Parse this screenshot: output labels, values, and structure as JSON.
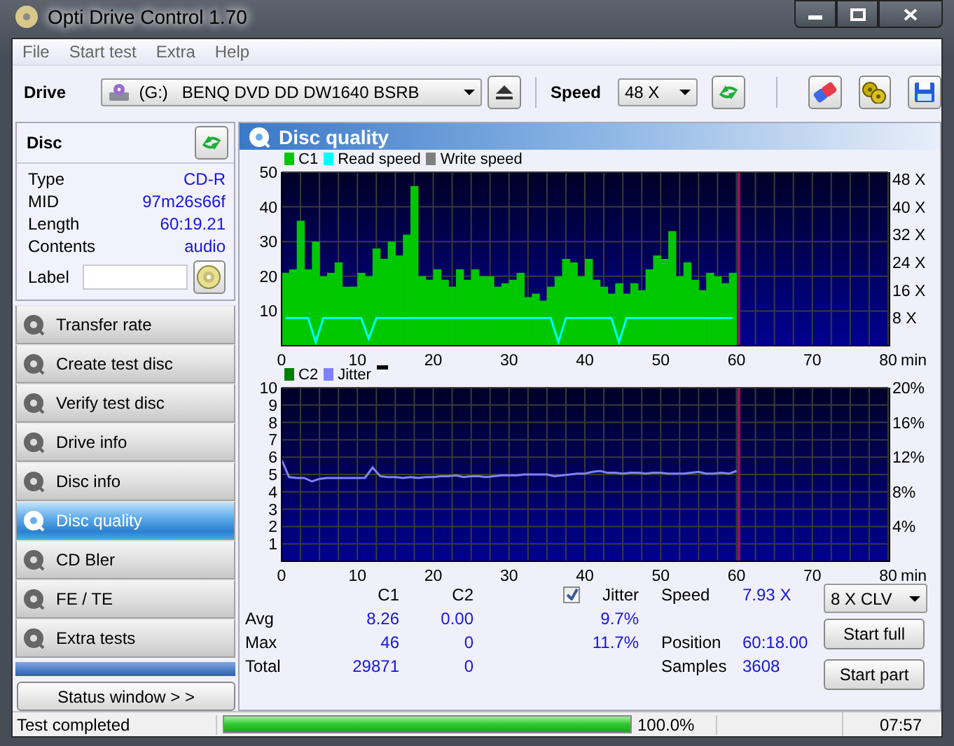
{
  "window": {
    "title": "Opti Drive Control 1.70"
  },
  "menu": [
    "File",
    "Start test",
    "Extra",
    "Help"
  ],
  "toolbar": {
    "drive_label": "Drive",
    "drive": "(G:)   BENQ DVD DD DW1640 BSRB",
    "speed_label": "Speed",
    "speed": "48 X"
  },
  "disc": {
    "title": "Disc",
    "info": [
      {
        "label": "Type",
        "value": "CD-R"
      },
      {
        "label": "MID",
        "value": "97m26s66f"
      },
      {
        "label": "Length",
        "value": "60:19.21"
      },
      {
        "label": "Contents",
        "value": "audio"
      }
    ],
    "label_field": "Label"
  },
  "nav": [
    {
      "label": "Transfer rate",
      "selected": false
    },
    {
      "label": "Create test disc",
      "selected": false
    },
    {
      "label": "Verify test disc",
      "selected": false
    },
    {
      "label": "Drive info",
      "selected": false
    },
    {
      "label": "Disc info",
      "selected": false
    },
    {
      "label": "Disc quality",
      "selected": true
    },
    {
      "label": "CD Bler",
      "selected": false
    },
    {
      "label": "FE / TE",
      "selected": false
    },
    {
      "label": "Extra tests",
      "selected": false
    }
  ],
  "status_window_button": "Status window > >",
  "panel": {
    "title": "Disc quality",
    "charts": [
      {
        "chart_data": {
          "type": "bar",
          "grid": true,
          "xlabel": "min",
          "xlim": [
            0,
            80
          ],
          "ylim": [
            0,
            50
          ],
          "xticks": [
            0,
            10,
            20,
            30,
            40,
            50,
            60,
            70,
            80
          ],
          "yticks": [
            10,
            20,
            30,
            40,
            50
          ],
          "y2lim": [
            0,
            50
          ],
          "y2ticks": [
            {
              "value": 8,
              "label": "8 X"
            },
            {
              "value": 16,
              "label": "16 X"
            },
            {
              "value": 24,
              "label": "24 X"
            },
            {
              "value": 32,
              "label": "32 X"
            },
            {
              "value": 40,
              "label": "40 X"
            },
            {
              "value": 48,
              "label": "48 X"
            }
          ],
          "x": [
            0.5,
            1.5,
            2.5,
            3.5,
            4.5,
            5.5,
            6.5,
            7.5,
            8.5,
            9.5,
            10.5,
            11.5,
            12.5,
            13.5,
            14.5,
            15.5,
            16.5,
            17.5,
            18.5,
            19.5,
            20.5,
            21.5,
            22.5,
            23.5,
            24.5,
            25.5,
            26.5,
            27.5,
            28.5,
            29.5,
            30.5,
            31.5,
            32.5,
            33.5,
            34.5,
            35.5,
            36.5,
            37.5,
            38.5,
            39.5,
            40.5,
            41.5,
            42.5,
            43.5,
            44.5,
            45.5,
            46.5,
            47.5,
            48.5,
            49.5,
            50.5,
            51.5,
            52.5,
            53.5,
            54.5,
            55.5,
            56.5,
            57.5,
            58.5,
            59.5
          ],
          "ref_lines": [
            {
              "axis": "x",
              "value": 60.3,
              "color": "#99106a"
            }
          ],
          "series": [
            {
              "name": "C1",
              "color": "#00c800",
              "values": [
                21,
                22,
                36,
                22,
                30,
                20,
                21,
                24,
                17,
                17,
                21,
                20,
                28,
                25,
                30,
                26,
                32,
                46,
                20,
                19,
                22,
                19,
                17,
                22,
                19,
                22,
                20,
                20,
                17,
                18,
                19,
                21,
                14,
                15,
                13,
                17,
                20,
                25,
                24,
                20,
                25,
                19,
                17,
                15,
                18,
                15,
                18,
                16,
                22,
                26,
                25,
                33,
                20,
                24,
                19,
                16,
                21,
                20,
                18,
                21
              ]
            },
            {
              "name": "Read speed",
              "color": "#00ffff",
              "type": "line",
              "axis": "y2",
              "values": [
                8,
                8,
                8,
                8,
                1,
                8,
                8,
                8,
                8,
                8,
                8,
                2,
                8,
                8,
                8,
                8,
                8,
                8,
                8,
                8,
                8,
                8,
                8,
                8,
                8,
                8,
                8,
                8,
                8,
                8,
                8,
                8,
                8,
                8,
                8,
                8,
                1,
                8,
                8,
                8,
                8,
                8,
                8,
                8,
                1,
                8,
                8,
                8,
                8,
                8,
                8,
                8,
                8,
                8,
                8,
                8,
                8,
                8,
                8,
                8
              ]
            },
            {
              "name": "Write speed",
              "color": "#808080",
              "type": "line",
              "axis": "y2",
              "values": [
                null,
                null,
                null,
                null,
                null,
                null,
                null,
                null,
                null,
                null,
                null,
                null,
                null,
                null,
                null,
                null,
                null,
                null,
                null,
                null,
                null,
                null,
                null,
                null,
                null,
                null,
                null,
                null,
                null,
                null,
                null,
                null,
                null,
                null,
                null,
                null,
                null,
                null,
                null,
                null,
                null,
                null,
                null,
                null,
                null,
                null,
                null,
                null,
                null,
                null,
                null,
                null,
                null,
                null,
                null,
                null,
                null,
                null,
                null,
                null
              ]
            }
          ]
        }
      },
      {
        "chart_data": {
          "type": "bar",
          "grid": true,
          "xlabel": "min",
          "xlim": [
            0,
            80
          ],
          "ylim": [
            0,
            10
          ],
          "xticks": [
            0,
            10,
            20,
            30,
            40,
            50,
            60,
            70,
            80
          ],
          "yticks": [
            1,
            2,
            3,
            4,
            5,
            6,
            7,
            8,
            9,
            10
          ],
          "y2lim": [
            0,
            20
          ],
          "y2ticks": [
            {
              "value": 4,
              "label": "4%"
            },
            {
              "value": 8,
              "label": "8%"
            },
            {
              "value": 12,
              "label": "12%"
            },
            {
              "value": 16,
              "label": "16%"
            },
            {
              "value": 20,
              "label": "20%"
            }
          ],
          "x": [
            0,
            1,
            2,
            3,
            4,
            5,
            6,
            7,
            8,
            9,
            10,
            11,
            12,
            13,
            14,
            15,
            16,
            17,
            18,
            19,
            20,
            21,
            22,
            23,
            24,
            25,
            26,
            27,
            28,
            29,
            30,
            31,
            32,
            33,
            34,
            35,
            36,
            37,
            38,
            39,
            40,
            41,
            42,
            43,
            44,
            45,
            46,
            47,
            48,
            49,
            50,
            51,
            52,
            53,
            54,
            55,
            56,
            57,
            58,
            59,
            60
          ],
          "ref_lines": [
            {
              "axis": "x",
              "value": 60.3,
              "color": "#99106a"
            }
          ],
          "series": [
            {
              "name": "C2",
              "color": "#008000",
              "values": [
                0,
                0,
                0,
                0,
                0,
                0,
                0,
                0,
                0,
                0,
                0,
                0,
                0,
                0,
                0,
                0,
                0,
                0,
                0,
                0,
                0,
                0,
                0,
                0,
                0,
                0,
                0,
                0,
                0,
                0,
                0,
                0,
                0,
                0,
                0,
                0,
                0,
                0,
                0,
                0,
                0,
                0,
                0,
                0,
                0,
                0,
                0,
                0,
                0,
                0,
                0,
                0,
                0,
                0,
                0,
                0,
                0,
                0,
                0,
                0,
                0
              ]
            },
            {
              "name": "Jitter",
              "color": "#8080ff",
              "type": "line",
              "axis": "y2",
              "values": [
                11.7,
                9.7,
                9.6,
                9.6,
                9.2,
                9.5,
                9.6,
                9.6,
                9.6,
                9.6,
                9.6,
                9.6,
                10.8,
                9.8,
                9.7,
                9.7,
                9.6,
                9.7,
                9.6,
                9.7,
                9.7,
                9.8,
                9.8,
                9.9,
                9.7,
                9.8,
                9.8,
                9.7,
                9.8,
                9.9,
                9.9,
                9.9,
                10,
                10,
                10,
                10,
                9.8,
                9.9,
                10,
                10.1,
                10.1,
                10.3,
                10.4,
                10.2,
                10.2,
                10.1,
                10.2,
                10.2,
                10.1,
                10.2,
                10.2,
                10.1,
                10.1,
                10.1,
                10.2,
                10.3,
                10.1,
                10.1,
                10.2,
                10.1,
                10.4
              ]
            }
          ]
        }
      }
    ],
    "stats": {
      "columns": [
        "C1",
        "C2"
      ],
      "jitter": {
        "label": "Jitter",
        "checked": true
      },
      "rows": [
        {
          "label": "Avg",
          "c1": "8.26",
          "c2": "0.00",
          "jitter": "9.7%"
        },
        {
          "label": "Max",
          "c1": "46",
          "c2": "0",
          "jitter": "11.7%"
        },
        {
          "label": "Total",
          "c1": "29871",
          "c2": "0"
        }
      ]
    },
    "readout": [
      {
        "label": "Speed",
        "value": "7.93 X"
      },
      {
        "label": "Position",
        "value": "60:18.00"
      },
      {
        "label": "Samples",
        "value": "3608"
      }
    ],
    "speed_mode": "8 X CLV",
    "buttons": [
      "Start full",
      "Start part"
    ]
  },
  "status_bar": {
    "message": "Test completed",
    "level": 1.0,
    "percent": "100.0%",
    "time": "07:57"
  }
}
